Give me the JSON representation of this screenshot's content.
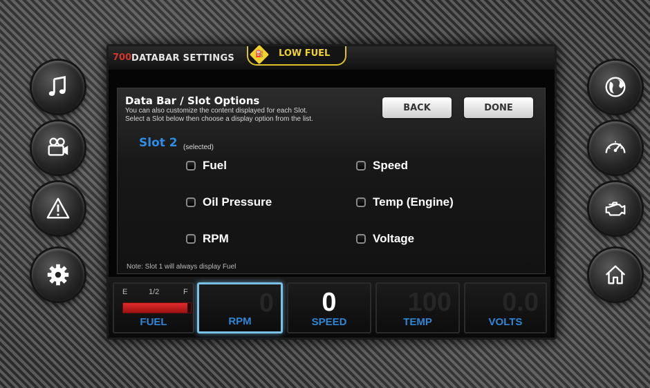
{
  "topbar": {
    "code": "700",
    "title": "DATABAR SETTINGS",
    "alert": "LOW FUEL"
  },
  "panel": {
    "title": "Data Bar / Slot Options",
    "desc_line1": "You can also customize the content displayed for each Slot.",
    "desc_line2": "Select a Slot below then choose a display option from the list.",
    "back_label": "BACK",
    "done_label": "DONE",
    "slot_title": "Slot 2",
    "slot_sub": "(selected)",
    "options": [
      "Fuel",
      "Speed",
      "Oil Pressure",
      "Temp (Engine)",
      "RPM",
      "Voltage"
    ],
    "note": "Note: Slot 1 will always display Fuel"
  },
  "databar": {
    "fuel": {
      "label": "FUEL",
      "e": "E",
      "half": "1/2",
      "f": "F",
      "level": 0.95
    },
    "tiles": [
      {
        "label": "RPM",
        "value": "0",
        "selected": true
      },
      {
        "label": "SPEED",
        "value": "0",
        "selected": false
      },
      {
        "label": "TEMP",
        "value": "100",
        "selected": false
      },
      {
        "label": "VOLTS",
        "value": "0.0",
        "selected": false
      }
    ]
  },
  "left_buttons": [
    "music-icon",
    "video-camera-icon",
    "warning-icon",
    "settings-gear-icon"
  ],
  "right_buttons": [
    "globe-icon",
    "speedometer-icon",
    "engine-icon",
    "home-icon"
  ],
  "colors": {
    "accent_blue": "#2e86d6",
    "alert_yellow": "#f1d22c",
    "fuel_red": "#e02a2a"
  }
}
